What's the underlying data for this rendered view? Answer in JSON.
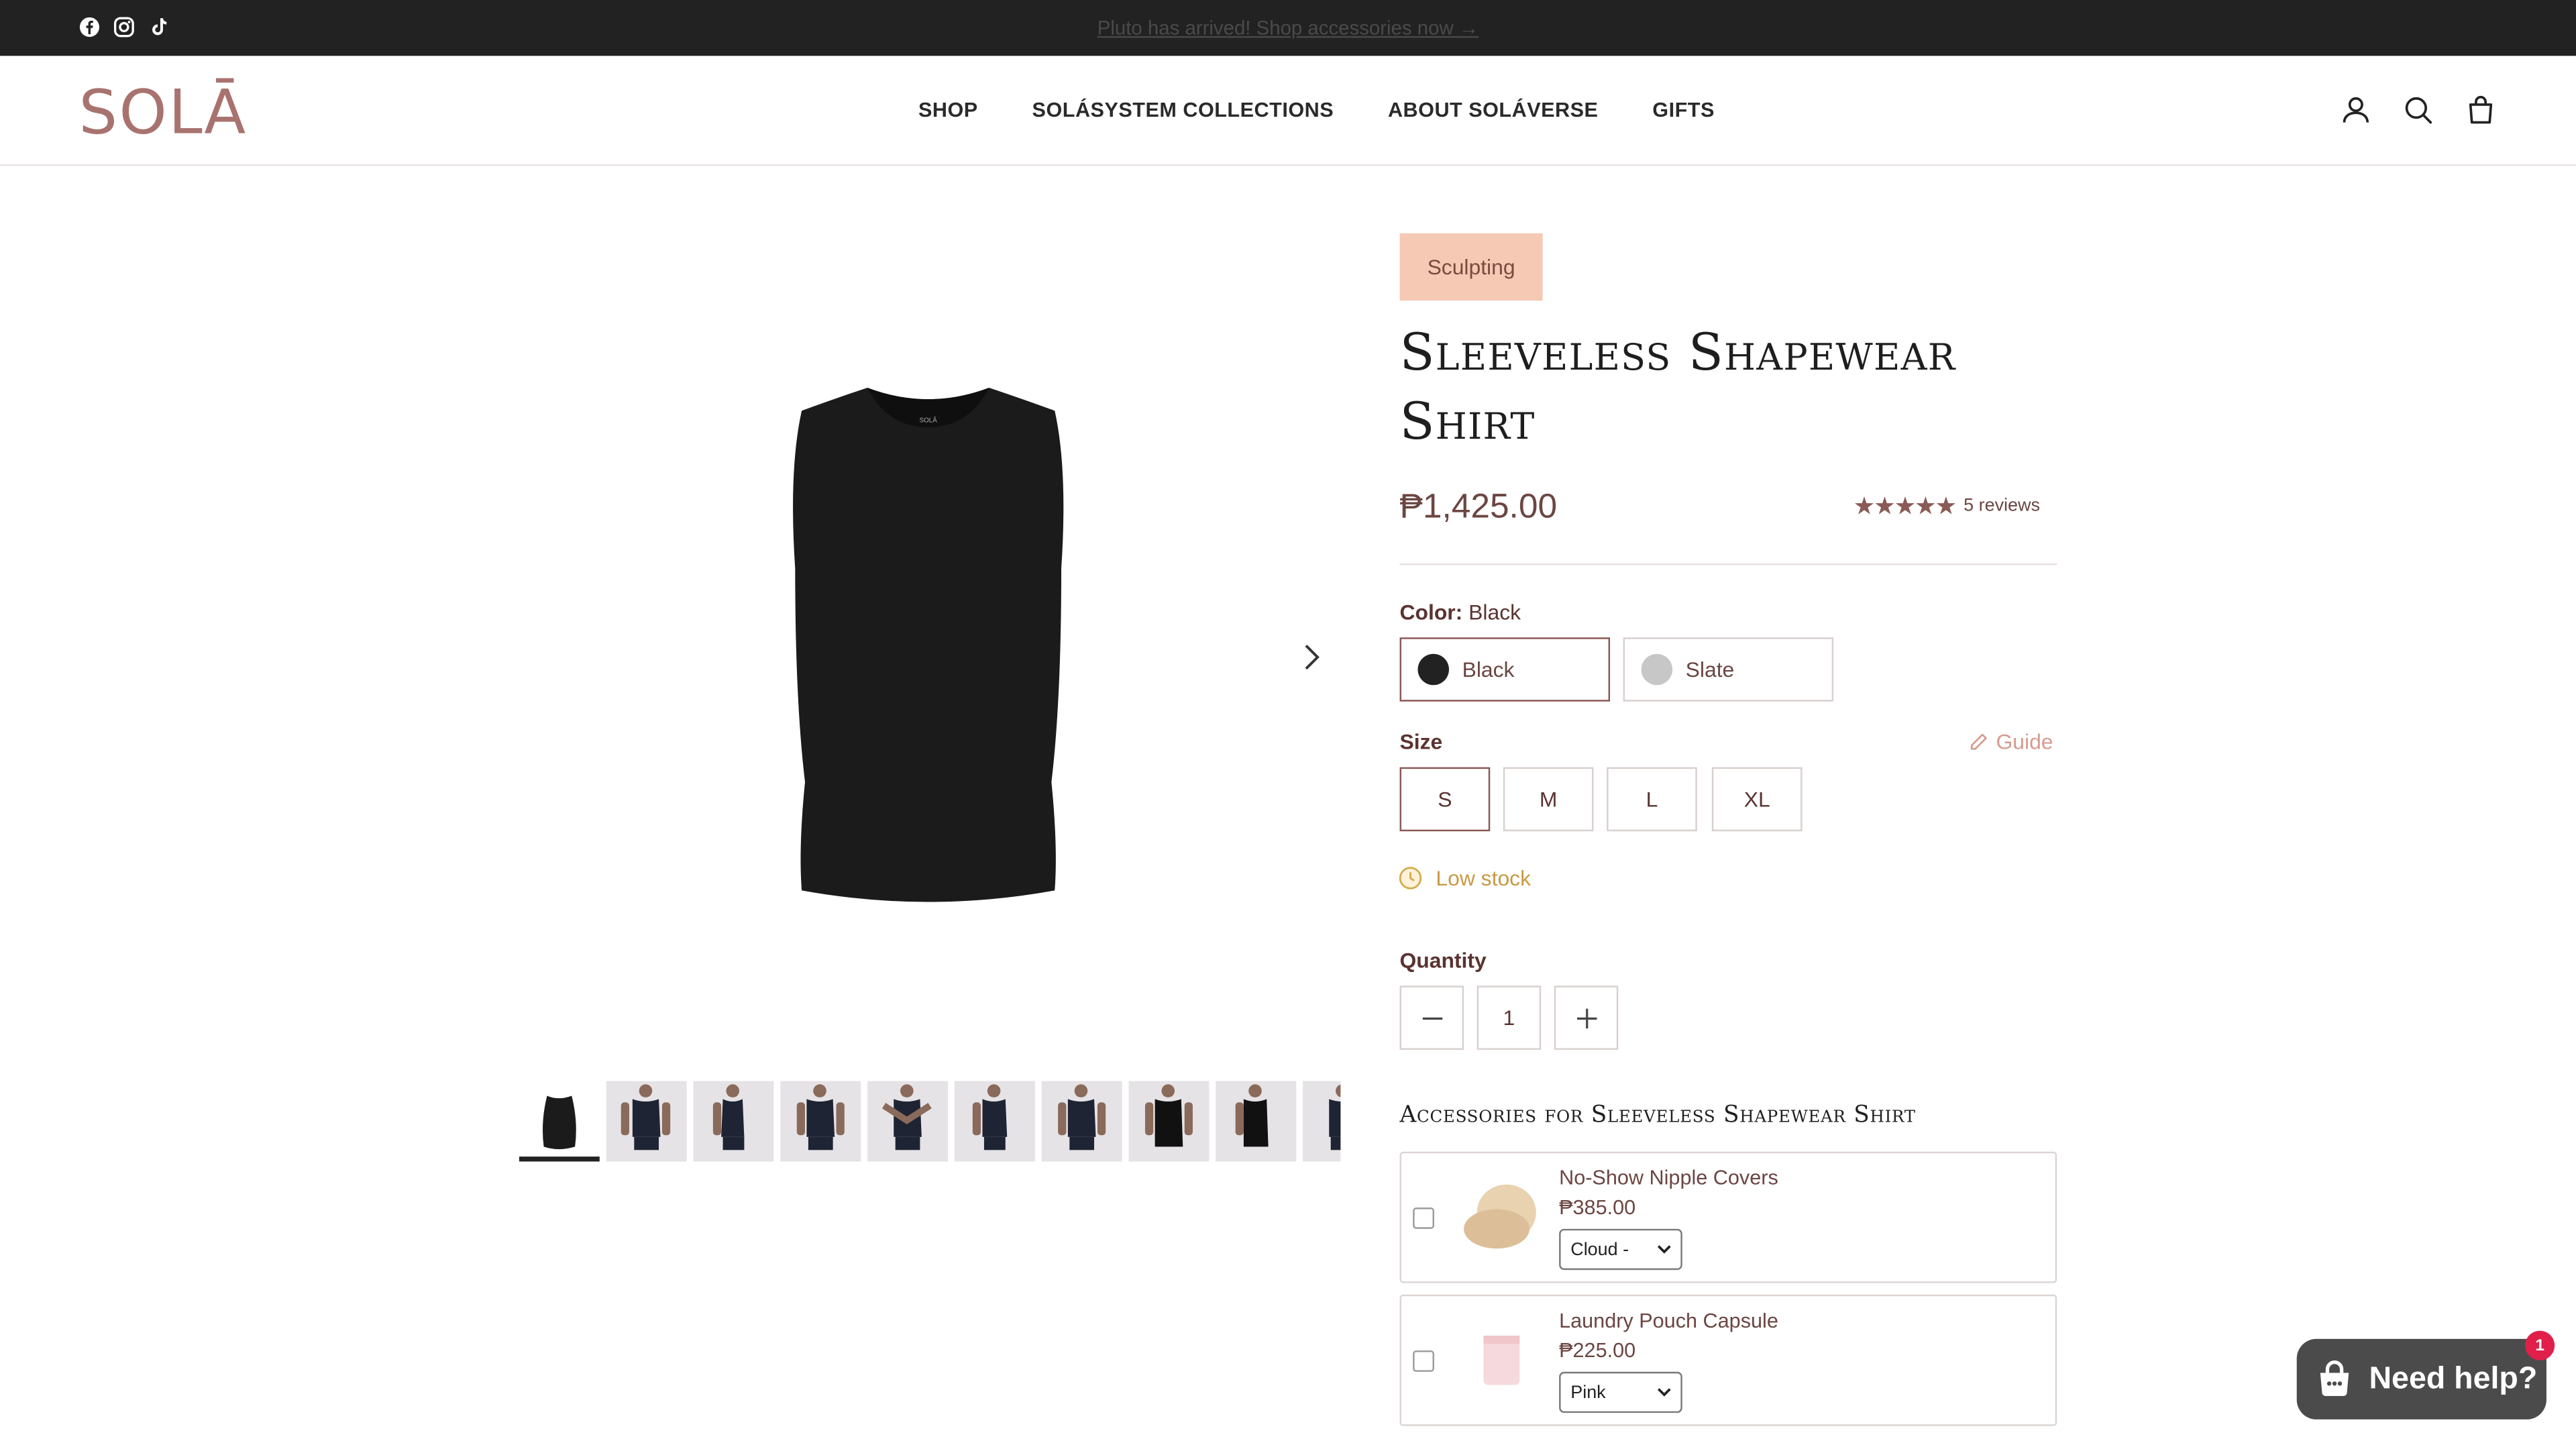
{
  "announcement": {
    "text": "Pluto has arrived! Shop accessories now →"
  },
  "header": {
    "logo": "SOLĀ",
    "nav": [
      "SHOP",
      "SOLÁSYSTEM COLLECTIONS",
      "ABOUT SOLÁVERSE",
      "GIFTS"
    ],
    "icons": [
      "account-icon",
      "search-icon",
      "cart-icon"
    ]
  },
  "social": [
    "facebook-icon",
    "instagram-icon",
    "tiktok-icon"
  ],
  "gallery": {
    "thumbnail_count": 10,
    "active_thumbnail": 1,
    "next_icon": "chevron-right-icon"
  },
  "product": {
    "badge": "Sculpting",
    "title": "Sleeveless Shapewear Shirt",
    "price": "₱1,425.00",
    "rating_stars": "★★★★★",
    "rating": 5,
    "reviews": "5 reviews",
    "color": {
      "label": "Color:",
      "selected": "Black",
      "options": [
        {
          "name": "Black",
          "swatch": "#222222"
        },
        {
          "name": "Slate",
          "swatch": "#c7c7c7"
        }
      ]
    },
    "size": {
      "label": "Size",
      "guide": "Guide",
      "selected": "S",
      "options": [
        "S",
        "M",
        "L",
        "XL"
      ]
    },
    "stock": "Low stock",
    "quantity": {
      "label": "Quantity",
      "value": "1"
    }
  },
  "accessories": {
    "title": "Accessories for Sleeveless Shapewear Shirt",
    "items": [
      {
        "name": "No-Show Nipple Covers",
        "price": "₱385.00",
        "option": "Cloud -"
      },
      {
        "name": "Laundry Pouch Capsule",
        "price": "₱225.00",
        "option": "Pink"
      }
    ]
  },
  "chat": {
    "label": "Need help?",
    "badge": "1"
  },
  "colors": {
    "brand": "#a8736f",
    "badge_bg": "#f6c9b5",
    "accent_border": "#8b5753",
    "stock": "#c89a45",
    "chat_bg": "#4b4b4b",
    "chat_badge": "#e0204a"
  }
}
